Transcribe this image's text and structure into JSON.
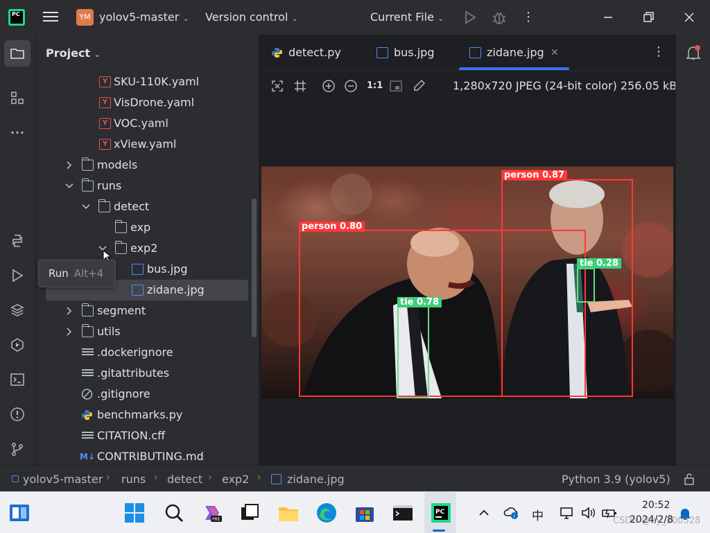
{
  "titlebar": {
    "app_logo": "PC",
    "project_badge": "YM",
    "project_name": "yolov5-master",
    "version_control": "Version control",
    "run_config": "Current File",
    "icons": [
      "hamburger-icon",
      "run-icon",
      "debug-icon",
      "more-vertical-icon",
      "minimize-icon",
      "maximize-icon",
      "close-icon"
    ]
  },
  "left_strip": {
    "icons": [
      "folder-icon",
      "structure-icon",
      "more-horizontal-icon",
      "python-console-icon",
      "run-icon",
      "layers-icon",
      "services-icon",
      "terminal-icon",
      "problems-icon",
      "git-icon"
    ]
  },
  "project_panel": {
    "title": "Project",
    "tree": [
      {
        "label": "SKU-110K.yaml",
        "type": "yaml"
      },
      {
        "label": "VisDrone.yaml",
        "type": "yaml"
      },
      {
        "label": "VOC.yaml",
        "type": "yaml"
      },
      {
        "label": "xView.yaml",
        "type": "yaml"
      },
      {
        "label": "models",
        "type": "folder",
        "state": "collapsed"
      },
      {
        "label": "runs",
        "type": "folder",
        "state": "expanded"
      },
      {
        "label": "detect",
        "type": "folder",
        "state": "expanded"
      },
      {
        "label": "exp",
        "type": "folder"
      },
      {
        "label": "exp2",
        "type": "folder",
        "state": "expanded"
      },
      {
        "label": "bus.jpg",
        "type": "image"
      },
      {
        "label": "zidane.jpg",
        "type": "image",
        "selected": true
      },
      {
        "label": "segment",
        "type": "folder",
        "state": "collapsed"
      },
      {
        "label": "utils",
        "type": "folder",
        "state": "collapsed"
      },
      {
        "label": ".dockerignore",
        "type": "text"
      },
      {
        "label": ".gitattributes",
        "type": "text"
      },
      {
        "label": ".gitignore",
        "type": "ignore"
      },
      {
        "label": "benchmarks.py",
        "type": "python"
      },
      {
        "label": "CITATION.cff",
        "type": "text"
      },
      {
        "label": "CONTRIBUTING.md",
        "type": "markdown"
      }
    ]
  },
  "tooltip": {
    "label": "Run",
    "shortcut": "Alt+4"
  },
  "editor": {
    "tabs": [
      {
        "label": "detect.py",
        "icon": "python-file-icon"
      },
      {
        "label": "bus.jpg",
        "icon": "image-file-icon"
      },
      {
        "label": "zidane.jpg",
        "icon": "image-file-icon",
        "active": true
      }
    ],
    "image_info": "1,280x720 JPEG (24-bit color) 256.05 kB",
    "zoom_actual": "1:1",
    "detections": [
      {
        "label": "person 0.87",
        "color": "#ff3838"
      },
      {
        "label": "person 0.80",
        "color": "#ff3838"
      },
      {
        "label": "tie 0.78",
        "color": "#48f90a"
      },
      {
        "label": "tie 0.28",
        "color": "#48f90a"
      }
    ]
  },
  "statusbar": {
    "breadcrumbs": [
      "yolov5-master",
      "runs",
      "detect",
      "exp2",
      "zidane.jpg"
    ],
    "interpreter": "Python 3.9 (yolov5)"
  },
  "taskbar": {
    "apps": [
      "start-icon",
      "search-icon",
      "copilot-icon",
      "task-view-icon",
      "file-explorer-icon",
      "edge-icon",
      "store-icon",
      "terminal-icon",
      "pycharm-icon"
    ],
    "tray": {
      "ime": "中",
      "time": "20:52",
      "date": "2024/2/8",
      "watermark": "CSDN @ny_200528"
    }
  }
}
